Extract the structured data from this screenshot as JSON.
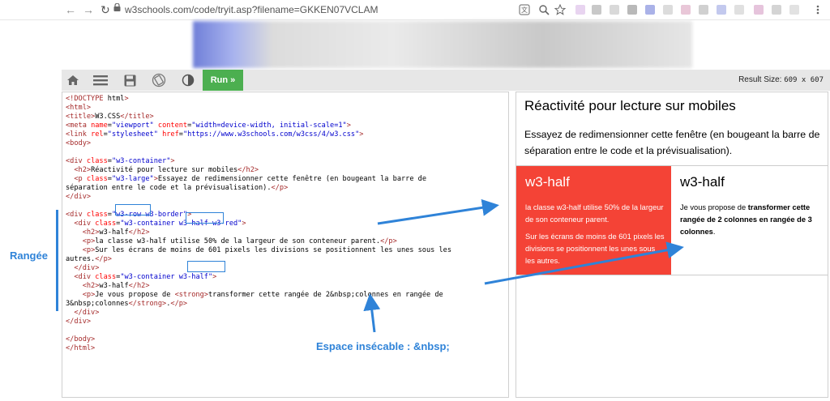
{
  "browser": {
    "url": "w3schools.com/code/tryit.asp?filename=GKKEN07VCLAM",
    "icons": [
      "back-icon",
      "forward-icon",
      "reload-icon",
      "lock-icon",
      "translate-icon",
      "zoom-icon",
      "star-icon",
      "menu-icon"
    ]
  },
  "toolbar": {
    "run_label": "Run »",
    "result_size_label": "Result Size:",
    "result_size_value": "609 x 607",
    "icons": [
      "home-icon",
      "menu-icon",
      "save-icon",
      "rotate-icon",
      "contrast-icon"
    ]
  },
  "editor": {
    "lines": [
      "<!DOCTYPE html>",
      "<html>",
      "<title>W3.CSS</title>",
      "<meta name=\"viewport\" content=\"width=device-width, initial-scale=1\">",
      "<link rel=\"stylesheet\" href=\"https://www.w3schools.com/w3css/4/w3.css\">",
      "<body>",
      "",
      "<div class=\"w3-container\">",
      "  <h2>Réactivité pour lecture sur mobiles</h2>",
      "  <p class=\"w3-large\">Essayez de redimensionner cette fenêtre (en bougeant la barre de",
      "séparation entre le code et la prévisualisation).</p>",
      "</div>",
      "",
      "<div class=\"w3-row w3-border\">",
      "  <div class=\"w3-container w3-half w3-red\">",
      "    <h2>w3-half</h2>",
      "    <p>la classe w3-half utilise 50% de la largeur de son conteneur parent.</p>",
      "    <p>Sur les écrans de moins de 601 pixels les divisions se positionnent les unes sous les",
      "autres.</p>",
      "  </div>",
      "  <div class=\"w3-container w3-half\">",
      "    <h2>w3-half</h2>",
      "    <p>Je vous propose de <strong>transformer cette rangée de 2&nbsp;colonnes en rangée de",
      "3&nbsp;colonnes</strong>.</p>",
      "  </div>",
      "</div>",
      "",
      "</body>",
      "</html>"
    ]
  },
  "result": {
    "title": "Réactivité pour lecture sur mobiles",
    "paragraph": "Essayez de redimensionner cette fenêtre (en bougeant la barre de séparation entre le code et la prévisualisation).",
    "col1": {
      "heading": "w3-half",
      "p1": "la classe w3-half utilise 50% de la largeur de son conteneur parent.",
      "p2": "Sur les écrans de moins de 601 pixels les divisions se positionnent les unes sous les autres."
    },
    "col2": {
      "heading": "w3-half",
      "p_prefix": "Je vous propose de ",
      "p_strong": "transformer cette rangée de 2 colonnes en rangée de 3 colonnes",
      "p_suffix": "."
    }
  },
  "annotations": {
    "row_label": "Rangée",
    "nbsp_label": "Espace insécable : &nbsp;"
  },
  "colors": {
    "accent": "#2f83d8",
    "run_button": "#4caf50",
    "w3_red": "#f44336"
  }
}
